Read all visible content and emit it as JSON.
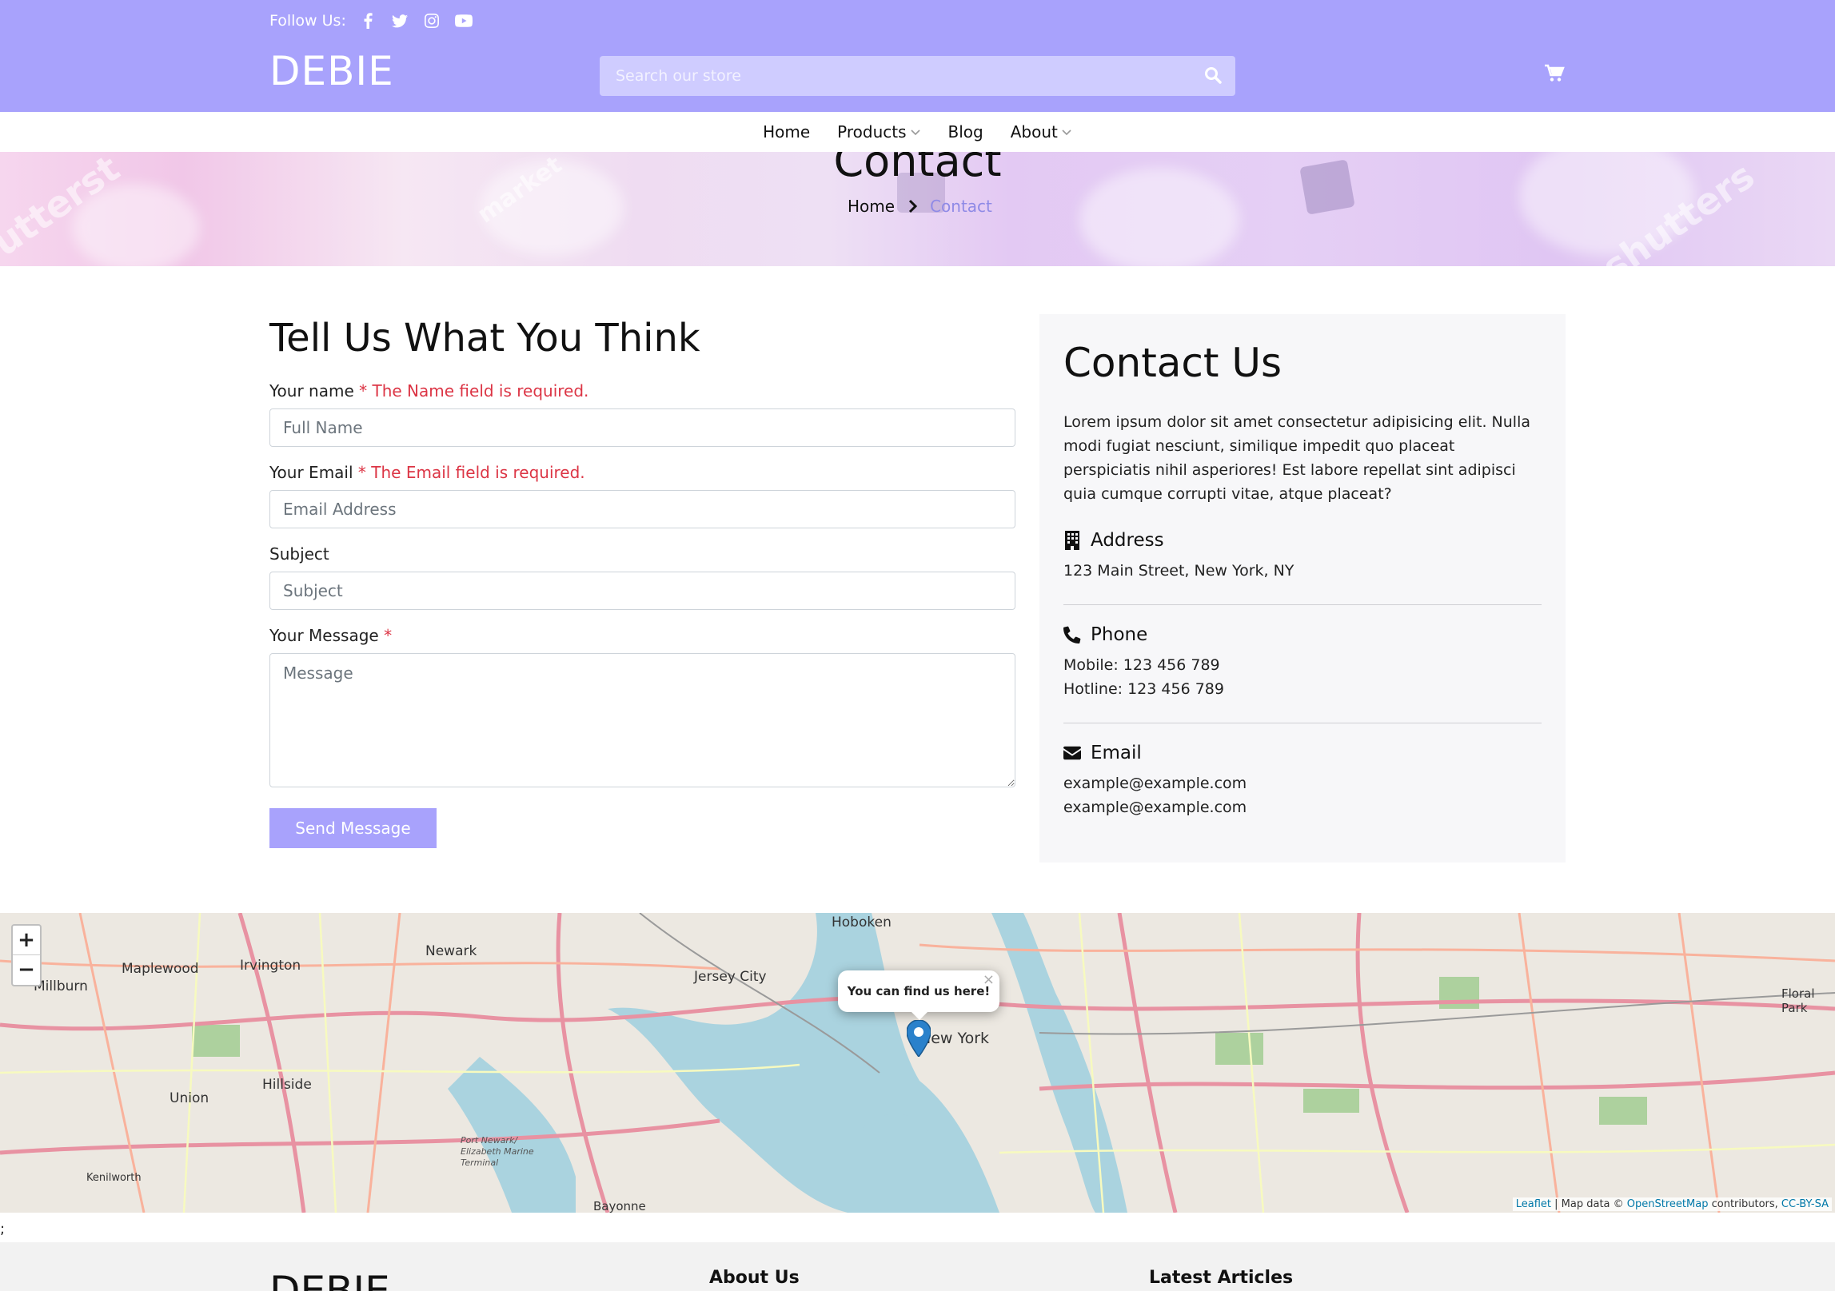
{
  "header": {
    "follow_label": "Follow Us:",
    "social_icons": [
      "facebook-icon",
      "twitter-icon",
      "instagram-icon",
      "youtube-icon"
    ],
    "logo": "DEBIE",
    "search_placeholder": "Search our store",
    "accent_color": "#a8a2fc"
  },
  "nav": {
    "items": [
      {
        "label": "Home",
        "dropdown": false
      },
      {
        "label": "Products",
        "dropdown": true
      },
      {
        "label": "Blog",
        "dropdown": false
      },
      {
        "label": "About",
        "dropdown": true
      }
    ]
  },
  "banner": {
    "title": "Contact",
    "breadcrumb": {
      "home": "Home",
      "current": "Contact"
    }
  },
  "form": {
    "title": "Tell Us What You Think",
    "name_label": "Your name",
    "name_required": "*",
    "name_error": "The Name field is required.",
    "name_placeholder": "Full Name",
    "email_label": "Your Email",
    "email_required": "*",
    "email_error": "The Email field is required.",
    "email_placeholder": "Email Address",
    "subject_label": "Subject",
    "subject_placeholder": "Subject",
    "message_label": "Your Message",
    "message_required": "*",
    "message_placeholder": "Message",
    "submit_label": "Send Message"
  },
  "contact": {
    "title": "Contact Us",
    "lead": "Lorem ipsum dolor sit amet consectetur adipisicing elit. Nulla modi fugiat nesciunt, similique impedit quo placeat perspiciatis nihil asperiores! Est labore repellat sint adipisci quia cumque corrupti vitae, atque placeat?",
    "address_title": "Address",
    "address": "123 Main Street, New York, NY",
    "phone_title": "Phone",
    "mobile": "Mobile: 123 456 789",
    "hotline": "Hotline: 123 456 789",
    "email_title": "Email",
    "email1": "example@example.com",
    "email2": "example@example.com"
  },
  "map": {
    "zoom_in": "+",
    "zoom_out": "−",
    "popup_text": "You can find us here!",
    "popup_close": "×",
    "attr_leaflet": "Leaflet",
    "attr_mid": " | Map data © ",
    "attr_osm": "OpenStreetMap",
    "attr_contrib": " contributors, ",
    "attr_license": "CC-BY-SA",
    "labels": [
      "Newark",
      "Irvington",
      "Maplewood",
      "Millburn",
      "Hoboken",
      "Jersey City",
      "New York",
      "Union",
      "Hillside",
      "Kenilworth",
      "Bayonne",
      "Floral Park",
      "Port Newark/ Elizabeth Marine Terminal"
    ]
  },
  "stray_text": ";",
  "footer": {
    "logo": "DEBIE",
    "about_title": "About Us",
    "articles_title": "Latest Articles"
  }
}
